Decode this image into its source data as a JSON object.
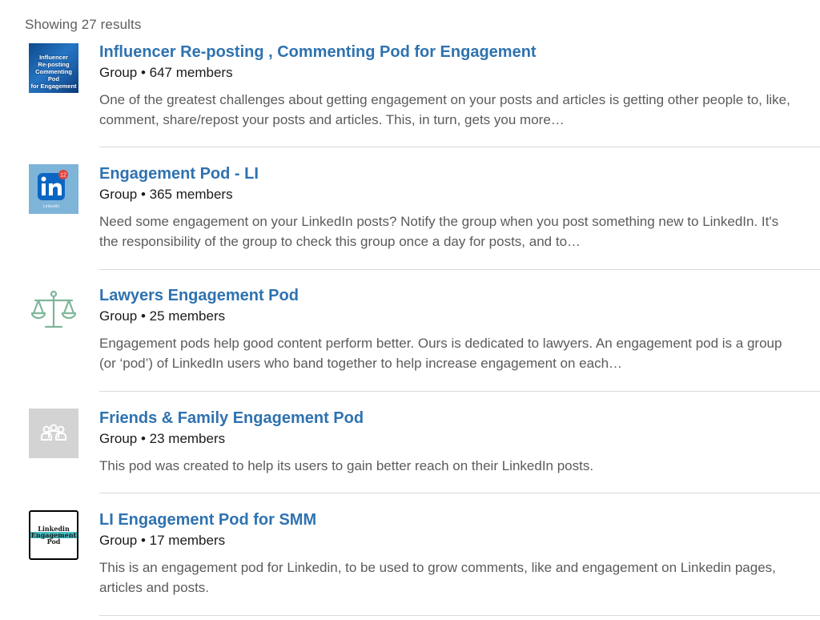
{
  "results_count": "Showing 27 results",
  "results": [
    {
      "title": "Influencer Re-posting , Commenting Pod for Engagement",
      "meta": "Group • 647 members",
      "description": "One of the greatest challenges about getting engagement on your posts and articles is getting other people to, like, comment, share/repost your posts and articles. This, in turn, gets you more…",
      "thumb_lines": [
        "Influencer",
        "Re-posting",
        "Commenting Pod",
        "for Engagement"
      ]
    },
    {
      "title": "Engagement Pod - LI",
      "meta": "Group • 365 members",
      "description": "Need some engagement on your LinkedIn posts? Notify the group when you post something new to LinkedIn. It's the responsibility of the group to check this group once a day for posts, and to…",
      "thumb_badge": "12",
      "thumb_label": "LinkedIn"
    },
    {
      "title": "Lawyers Engagement Pod",
      "meta": "Group • 25 members",
      "description": "Engagement pods help good content perform better. Ours is dedicated to lawyers. An engagement pod is a group (or ‘pod’) of LinkedIn users who band together to help increase engagement on each…"
    },
    {
      "title": "Friends & Family Engagement Pod",
      "meta": "Group • 23 members",
      "description": "This pod was created to help its users to gain better reach on their LinkedIn posts."
    },
    {
      "title": "LI Engagement Pod for SMM",
      "meta": "Group • 17 members",
      "description": "This is an engagement pod for Linkedin, to be used to grow comments, like and engagement on Linkedin pages, articles and posts.",
      "thumb_lines": [
        "Linkedin",
        "Engagement",
        "Pod"
      ]
    }
  ],
  "colors": {
    "link": "#2e72b0",
    "muted_text": "#5b5b5b",
    "divider": "#d9d9d9",
    "scales_icon": "#7fb69a"
  },
  "icons": [
    "linkedin-logo-icon",
    "scales-of-justice-icon",
    "group-people-icon"
  ]
}
